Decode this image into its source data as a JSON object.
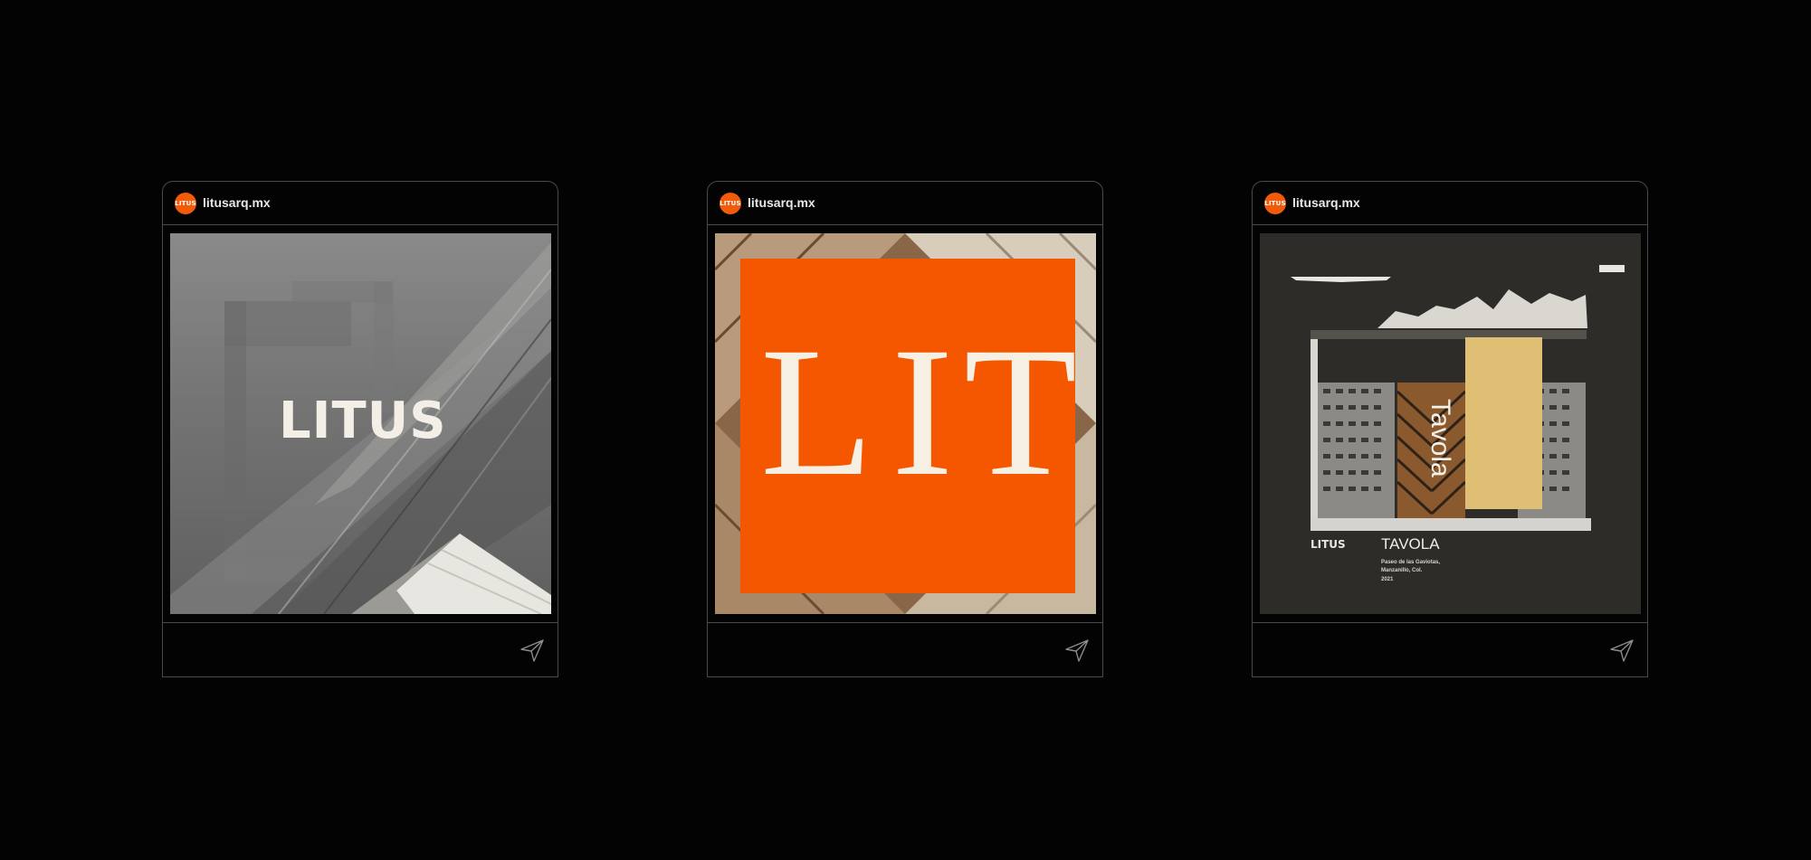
{
  "posts": [
    {
      "avatar_label": "LITUS",
      "username": "litusarq.mx",
      "media": {
        "logo_text": "LITUS"
      },
      "send_icon": "send-icon"
    },
    {
      "avatar_label": "LITUS",
      "username": "litusarq.mx",
      "media": {
        "glyphs": [
          "L",
          "I",
          "T"
        ],
        "accent_color": "#f45700"
      },
      "send_icon": "send-icon"
    },
    {
      "avatar_label": "LITUS",
      "username": "litusarq.mx",
      "media": {
        "brand": "LITUS",
        "title": "TAVOLA",
        "vertical_sign": "Tavola",
        "meta_lines": [
          "Paseo de las Gaviotas,",
          "Manzanillo, Col.",
          "2021"
        ]
      },
      "send_icon": "send-icon"
    }
  ],
  "colors": {
    "background": "#030303",
    "border": "#4a4a4a",
    "brand_orange": "#f25b0a"
  }
}
